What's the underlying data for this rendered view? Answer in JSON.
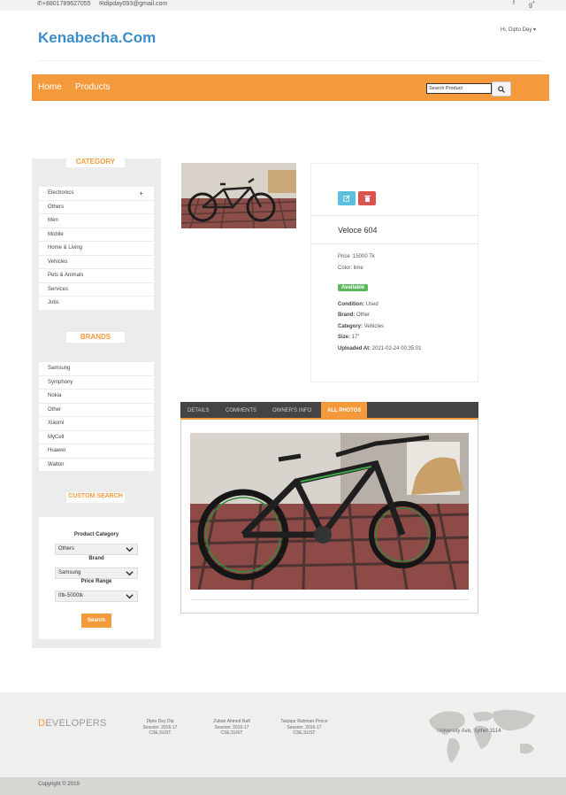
{
  "topbar": {
    "phone": "+8801789627055",
    "email": "dipday093@gmail.com",
    "social": [
      "facebook-icon",
      "google-plus-icon"
    ]
  },
  "header": {
    "logo": "Kenabecha.Com",
    "user_menu": "Hi, Dipto Dey"
  },
  "nav": {
    "links": [
      "Home",
      "Products"
    ],
    "search_placeholder": "Search Product"
  },
  "sidebar": {
    "category_title": "CATEGORY",
    "categories": [
      "Electronics",
      "Others",
      "Men",
      "Mobile",
      "Home & Living",
      "Vehicles",
      "Pets & Animals",
      "Services",
      "Jobs"
    ],
    "brands_title": "BRANDS",
    "brands": [
      "Samsung",
      "Symphony",
      "Nokia",
      "Other",
      "Xiaomi",
      "MyCell",
      "Huawei",
      "Walton"
    ],
    "custom_search": {
      "title": "CUSTOM SEARCH",
      "category_label": "Product Category",
      "category_value": "Others",
      "brand_label": "Brand",
      "brand_value": "Samsung",
      "price_label": "Price Range",
      "price_value": "0tk-5000tk",
      "button": "Search"
    }
  },
  "product": {
    "name": "Veloce 604",
    "price": "Price :15000 Tk",
    "color": "Color: lime",
    "status": "Available",
    "condition_label": "Condition:",
    "condition": "Used",
    "brand_label": "Brand:",
    "brand": "Other",
    "category_label": "Category:",
    "category": "Vehicles",
    "size_label": "Size:",
    "size": "17\"",
    "uploaded_label": "Uploaded At:",
    "uploaded": "2021-02-24 00:35:01"
  },
  "tabs": [
    "DETAILS",
    "COMMENTS",
    "OWNER'S INFO",
    "ALL PHOTOS"
  ],
  "footer": {
    "developers_first": "D",
    "developers_rest": "EVELOPERS",
    "devs": [
      {
        "name": "Dipto Dey Dip",
        "session": "Session: 2016-17",
        "dept": "CSE,SUST"
      },
      {
        "name": "Zubair Ahmed Rafi",
        "session": "Session: 2016-17",
        "dept": "CSE,SUST"
      },
      {
        "name": "Tanjiqur Rahman Prince",
        "session": "Session: 2016-17",
        "dept": "CSE,SUST"
      }
    ],
    "address": "University Ave, Sylhet 3114",
    "copyright": "Copyright © 2019"
  },
  "colors": {
    "brand_blue": "#3b8ecb",
    "accent_orange": "#f49a3d",
    "available_green": "#5cb85c",
    "edit_blue": "#5bc0de",
    "delete_red": "#d9534f"
  }
}
